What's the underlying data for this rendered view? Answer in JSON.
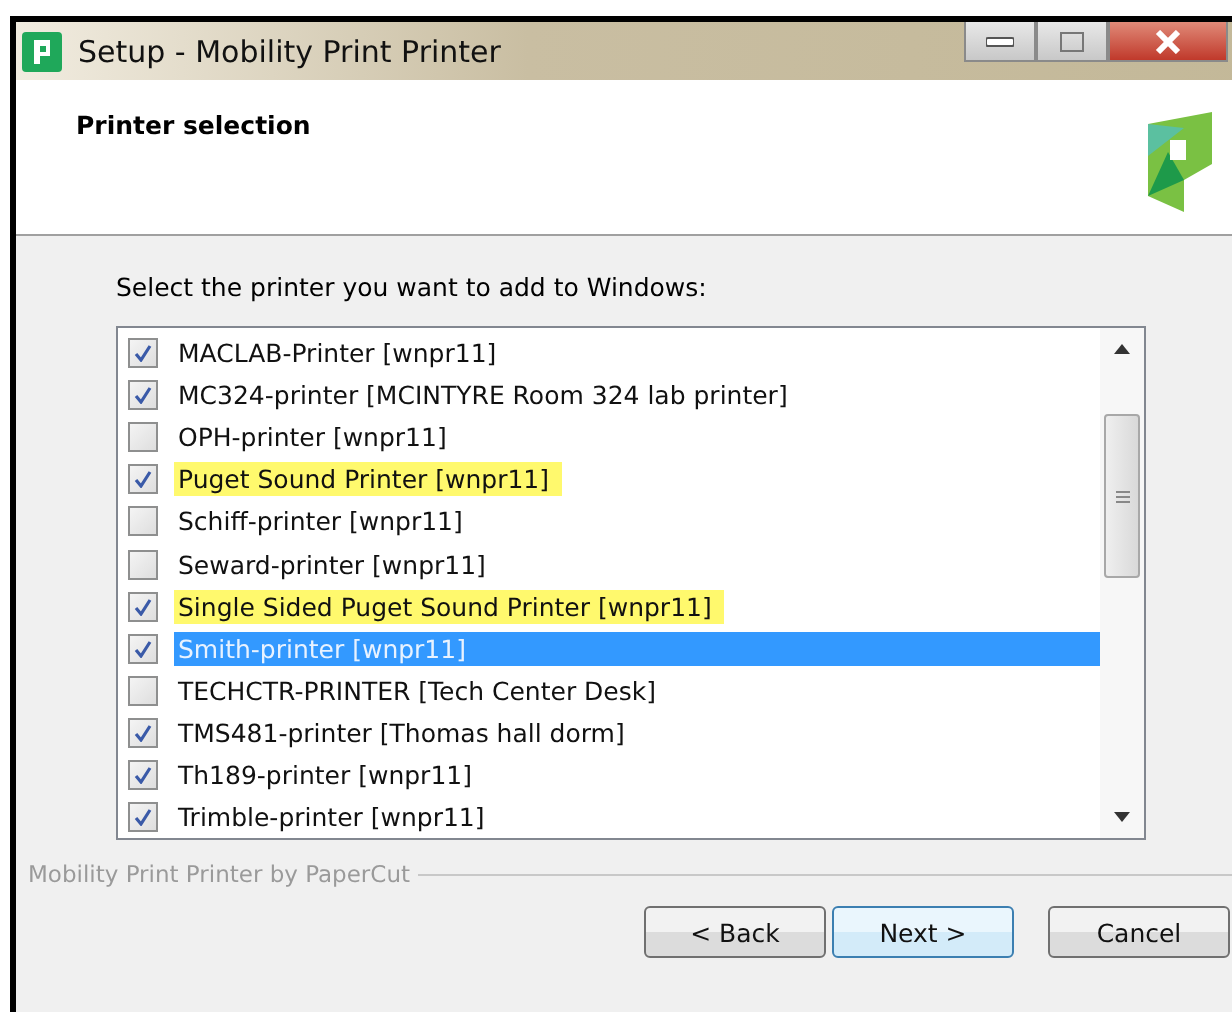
{
  "window": {
    "title": "Setup - Mobility Print Printer"
  },
  "header": {
    "title": "Printer selection"
  },
  "prompt": "Select the printer you want to add to Windows:",
  "printers": [
    {
      "label": "MACLAB-Printer [wnpr11]",
      "checked": true,
      "highlighted": false,
      "selected": false
    },
    {
      "label": "MC324-printer [MCINTYRE Room 324 lab printer]",
      "checked": true,
      "highlighted": false,
      "selected": false
    },
    {
      "label": "OPH-printer [wnpr11]",
      "checked": false,
      "highlighted": false,
      "selected": false
    },
    {
      "label": "Puget Sound Printer [wnpr11]",
      "checked": true,
      "highlighted": true,
      "selected": false
    },
    {
      "label": "Schiff-printer [wnpr11]",
      "checked": false,
      "highlighted": false,
      "selected": false
    },
    {
      "label": "Seward-printer [wnpr11]",
      "checked": false,
      "highlighted": false,
      "selected": false
    },
    {
      "label": "Single Sided Puget Sound Printer [wnpr11]",
      "checked": true,
      "highlighted": true,
      "selected": false
    },
    {
      "label": "Smith-printer [wnpr11]",
      "checked": true,
      "highlighted": false,
      "selected": true
    },
    {
      "label": "TECHCTR-PRINTER [Tech Center Desk]",
      "checked": false,
      "highlighted": false,
      "selected": false
    },
    {
      "label": "TMS481-printer [Thomas hall dorm]",
      "checked": true,
      "highlighted": false,
      "selected": false
    },
    {
      "label": "Th189-printer [wnpr11]",
      "checked": true,
      "highlighted": false,
      "selected": false
    },
    {
      "label": "Trimble-printer [wnpr11]",
      "checked": true,
      "highlighted": false,
      "selected": false
    }
  ],
  "footer": {
    "brand": "Mobility Print Printer by PaperCut"
  },
  "buttons": [
    {
      "label": "< Back",
      "default": false
    },
    {
      "label": "Next >",
      "default": true
    },
    {
      "label": "Cancel",
      "default": false
    }
  ]
}
